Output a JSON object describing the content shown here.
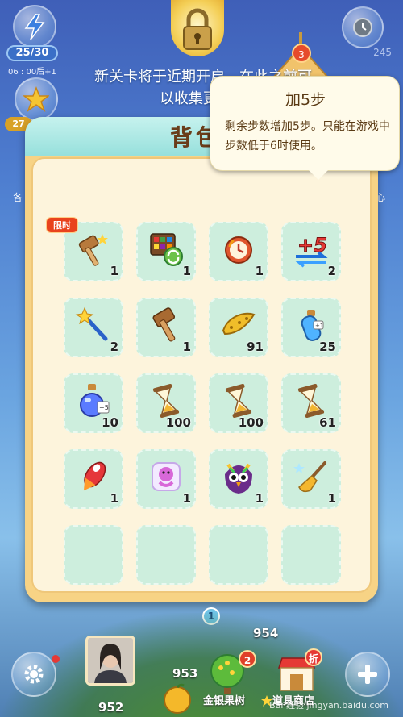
{
  "hud": {
    "energy": "25/30",
    "timer": "06 : 00后+1",
    "coins_short": "27",
    "right_count": "245",
    "level_badge": "3"
  },
  "background_notice": {
    "line1": "新关卡将于近期开启，在此之前可",
    "line2": "以收集更多的"
  },
  "side_labels": {
    "left": "各",
    "right": "心"
  },
  "backpack": {
    "title": "背包",
    "limited_tag": "限时",
    "page": "1",
    "items": [
      {
        "icon": "hammer-icon",
        "count": "1"
      },
      {
        "icon": "shuffle-board-icon",
        "count": "1"
      },
      {
        "icon": "alarm-clock-icon",
        "count": "1"
      },
      {
        "icon": "plus-five-moves-icon",
        "count": "2",
        "badge": "+5"
      },
      {
        "icon": "magic-wand-icon",
        "count": "2"
      },
      {
        "icon": "wooden-hammer-icon",
        "count": "1"
      },
      {
        "icon": "banana-icon",
        "count": "91"
      },
      {
        "icon": "blue-potion-small-icon",
        "count": "25",
        "badge": "+1"
      },
      {
        "icon": "blue-potion-large-icon",
        "count": "10",
        "badge": "+5"
      },
      {
        "icon": "hourglass-icon",
        "count": "100"
      },
      {
        "icon": "hourglass-icon",
        "count": "100"
      },
      {
        "icon": "hourglass-icon",
        "count": "61"
      },
      {
        "icon": "rocket-icon",
        "count": "1"
      },
      {
        "icon": "jelly-fairy-icon",
        "count": "1"
      },
      {
        "icon": "rainbow-owl-icon",
        "count": "1"
      },
      {
        "icon": "golden-broom-icon",
        "count": "1"
      }
    ]
  },
  "tooltip": {
    "title": "加5步",
    "body": "剩余步数增加5步。只能在游戏中步数低于6时使用。"
  },
  "bottom": {
    "player_score": "952",
    "score_left": "953",
    "score_top": "954",
    "orchard_label": "金银果树",
    "orchard_badge": "2",
    "shop_label": "道具商店",
    "shop_badge": "折",
    "watermark": "Bai 经验 jingyan.baidu.com"
  },
  "colors": {
    "panel": "#f7d385",
    "slot": "#cdeedd",
    "header": "#97e0dc",
    "tooltip": "#fffbea",
    "accent_red": "#e9431d"
  }
}
